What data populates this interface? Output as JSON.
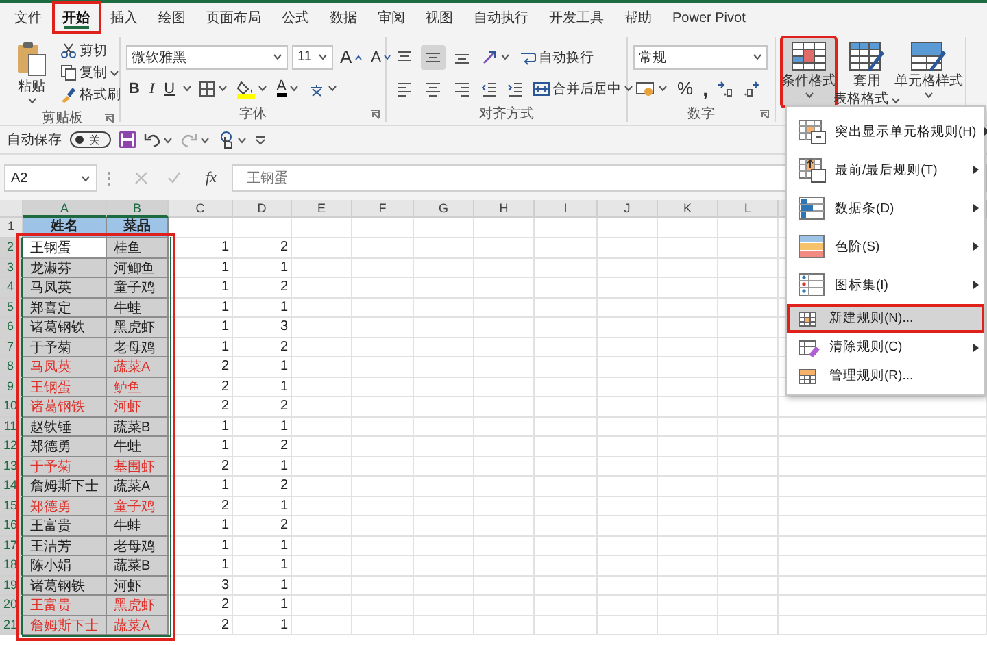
{
  "tabs": [
    {
      "label": "文件",
      "selected": false,
      "annotated": false
    },
    {
      "label": "开始",
      "selected": true,
      "annotated": true
    },
    {
      "label": "插入",
      "selected": false,
      "annotated": false
    },
    {
      "label": "绘图",
      "selected": false,
      "annotated": false
    },
    {
      "label": "页面布局",
      "selected": false,
      "annotated": false
    },
    {
      "label": "公式",
      "selected": false,
      "annotated": false
    },
    {
      "label": "数据",
      "selected": false,
      "annotated": false
    },
    {
      "label": "审阅",
      "selected": false,
      "annotated": false
    },
    {
      "label": "视图",
      "selected": false,
      "annotated": false
    },
    {
      "label": "自动执行",
      "selected": false,
      "annotated": false
    },
    {
      "label": "开发工具",
      "selected": false,
      "annotated": false
    },
    {
      "label": "帮助",
      "selected": false,
      "annotated": false
    },
    {
      "label": "Power Pivot",
      "selected": false,
      "annotated": false
    }
  ],
  "ribbon": {
    "clipboard": {
      "paste": "粘贴",
      "cut": "剪切",
      "copy": "复制",
      "format_painter": "格式刷",
      "label": "剪贴板"
    },
    "font": {
      "name": "微软雅黑",
      "size": "11",
      "grow": "A",
      "shrink": "A",
      "bold": "B",
      "italic": "I",
      "underline": "U",
      "color_button": "A",
      "label": "字体"
    },
    "alignment": {
      "vertical": [
        {
          "selected": false
        },
        {
          "selected": true
        },
        {
          "selected": false
        }
      ],
      "wrap": "自动换行",
      "merge": "合并后居中",
      "label": "对齐方式"
    },
    "number": {
      "format": "常规",
      "percent": "%",
      "comma": ",",
      "label": "数字"
    },
    "styles": [
      {
        "lines": [
          "条件格式"
        ],
        "selected": true,
        "annotated": true
      },
      {
        "lines": [
          "套用",
          "表格格式"
        ],
        "selected": false,
        "annotated": false
      },
      {
        "lines": [
          "单元格样式"
        ],
        "selected": false,
        "annotated": false
      }
    ]
  },
  "qat": {
    "autosave_label": "自动保存",
    "autosave_on": false,
    "toggle_text": "关"
  },
  "formula_bar": {
    "name_box": "A2",
    "fx": "fx",
    "formula": "王钢蛋"
  },
  "sheet": {
    "columns": [
      {
        "label": "A",
        "selected": true
      },
      {
        "label": "B",
        "selected": true
      },
      {
        "label": "C",
        "selected": false
      },
      {
        "label": "D",
        "selected": false
      },
      {
        "label": "E",
        "selected": false
      },
      {
        "label": "F",
        "selected": false
      },
      {
        "label": "G",
        "selected": false
      },
      {
        "label": "H",
        "selected": false
      },
      {
        "label": "I",
        "selected": false
      },
      {
        "label": "J",
        "selected": false
      },
      {
        "label": "K",
        "selected": false
      },
      {
        "label": "L",
        "selected": false
      }
    ],
    "header_row": {
      "number": "1",
      "selected": false,
      "cells": [
        "姓名",
        "菜品"
      ]
    },
    "range_annotated": true,
    "rows": [
      {
        "number": "2",
        "name": "王钢蛋",
        "dish": "桂鱼",
        "c": "1",
        "d": "2",
        "flagged": false,
        "selected": true,
        "active": true
      },
      {
        "number": "3",
        "name": "龙淑芬",
        "dish": "河鲫鱼",
        "c": "1",
        "d": "1",
        "flagged": false,
        "selected": true,
        "active": false
      },
      {
        "number": "4",
        "name": "马凤英",
        "dish": "童子鸡",
        "c": "1",
        "d": "2",
        "flagged": false,
        "selected": true,
        "active": false
      },
      {
        "number": "5",
        "name": "郑喜定",
        "dish": "牛蛙",
        "c": "1",
        "d": "1",
        "flagged": false,
        "selected": true,
        "active": false
      },
      {
        "number": "6",
        "name": "诸葛钢铁",
        "dish": "黑虎虾",
        "c": "1",
        "d": "3",
        "flagged": false,
        "selected": true,
        "active": false
      },
      {
        "number": "7",
        "name": "于予菊",
        "dish": "老母鸡",
        "c": "1",
        "d": "2",
        "flagged": false,
        "selected": true,
        "active": false
      },
      {
        "number": "8",
        "name": "马凤英",
        "dish": "蔬菜A",
        "c": "2",
        "d": "1",
        "flagged": true,
        "selected": true,
        "active": false
      },
      {
        "number": "9",
        "name": "王钢蛋",
        "dish": "鲈鱼",
        "c": "2",
        "d": "1",
        "flagged": true,
        "selected": true,
        "active": false
      },
      {
        "number": "10",
        "name": "诸葛钢铁",
        "dish": "河虾",
        "c": "2",
        "d": "2",
        "flagged": true,
        "selected": true,
        "active": false
      },
      {
        "number": "11",
        "name": "赵铁锤",
        "dish": "蔬菜B",
        "c": "1",
        "d": "1",
        "flagged": false,
        "selected": true,
        "active": false
      },
      {
        "number": "12",
        "name": "郑德勇",
        "dish": "牛蛙",
        "c": "1",
        "d": "2",
        "flagged": false,
        "selected": true,
        "active": false
      },
      {
        "number": "13",
        "name": "于予菊",
        "dish": "基围虾",
        "c": "2",
        "d": "1",
        "flagged": true,
        "selected": true,
        "active": false
      },
      {
        "number": "14",
        "name": "詹姆斯下士",
        "dish": "蔬菜A",
        "c": "1",
        "d": "2",
        "flagged": false,
        "selected": true,
        "active": false
      },
      {
        "number": "15",
        "name": "郑德勇",
        "dish": "童子鸡",
        "c": "2",
        "d": "1",
        "flagged": true,
        "selected": true,
        "active": false
      },
      {
        "number": "16",
        "name": "王富贵",
        "dish": "牛蛙",
        "c": "1",
        "d": "2",
        "flagged": false,
        "selected": true,
        "active": false
      },
      {
        "number": "17",
        "name": "王洁芳",
        "dish": "老母鸡",
        "c": "1",
        "d": "1",
        "flagged": false,
        "selected": true,
        "active": false
      },
      {
        "number": "18",
        "name": "陈小娟",
        "dish": "蔬菜B",
        "c": "1",
        "d": "1",
        "flagged": false,
        "selected": true,
        "active": false
      },
      {
        "number": "19",
        "name": "诸葛钢铁",
        "dish": "河虾",
        "c": "3",
        "d": "1",
        "flagged": false,
        "selected": true,
        "active": false
      },
      {
        "number": "20",
        "name": "王富贵",
        "dish": "黑虎虾",
        "c": "2",
        "d": "1",
        "flagged": true,
        "selected": true,
        "active": false
      },
      {
        "number": "21",
        "name": "詹姆斯下士",
        "dish": "蔬菜A",
        "c": "2",
        "d": "1",
        "flagged": true,
        "selected": true,
        "active": false
      }
    ]
  },
  "menu": {
    "items": [
      {
        "label": "突出显示单元格规则(H)",
        "submenu": true,
        "selected": false,
        "annotated": false
      },
      {
        "label": "最前/最后规则(T)",
        "submenu": true,
        "selected": false,
        "annotated": false
      },
      {
        "label": "数据条(D)",
        "submenu": true,
        "selected": false,
        "annotated": false
      },
      {
        "label": "色阶(S)",
        "submenu": true,
        "selected": false,
        "annotated": false
      },
      {
        "label": "图标集(I)",
        "submenu": true,
        "selected": false,
        "annotated": false
      },
      {
        "label": "新建规则(N)...",
        "submenu": false,
        "selected": true,
        "annotated": true
      },
      {
        "label": "清除规则(C)",
        "submenu": true,
        "selected": false,
        "annotated": false
      },
      {
        "label": "管理规则(R)...",
        "submenu": false,
        "selected": false,
        "annotated": false
      }
    ]
  }
}
